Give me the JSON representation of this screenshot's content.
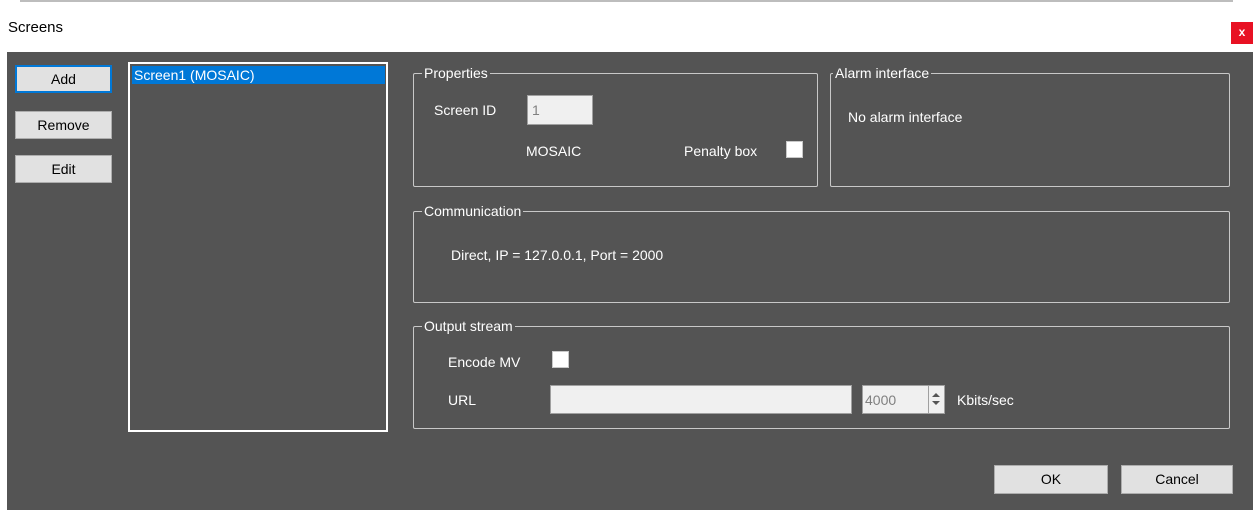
{
  "window": {
    "title": "Screens",
    "close_label": "x"
  },
  "buttons": {
    "add": "Add",
    "remove": "Remove",
    "edit": "Edit",
    "ok": "OK",
    "cancel": "Cancel"
  },
  "screens_list": {
    "items": [
      "Screen1 (MOSAIC)"
    ],
    "selected_index": 0
  },
  "properties": {
    "legend": "Properties",
    "screen_id_label": "Screen ID",
    "screen_id_value": "1",
    "type": "MOSAIC",
    "penalty_box_label": "Penalty box",
    "penalty_box_checked": false
  },
  "alarm": {
    "legend": "Alarm interface",
    "text": "No alarm interface"
  },
  "communication": {
    "legend": "Communication",
    "text": "Direct, IP = 127.0.0.1, Port = 2000"
  },
  "output_stream": {
    "legend": "Output stream",
    "encode_mv_label": "Encode MV",
    "encode_mv_checked": false,
    "url_label": "URL",
    "url_value": "",
    "bitrate_value": "4000",
    "bitrate_unit": "Kbits/sec"
  },
  "colors": {
    "dialog_bg": "#545454",
    "selection": "#0078d7",
    "close": "#e81123"
  }
}
